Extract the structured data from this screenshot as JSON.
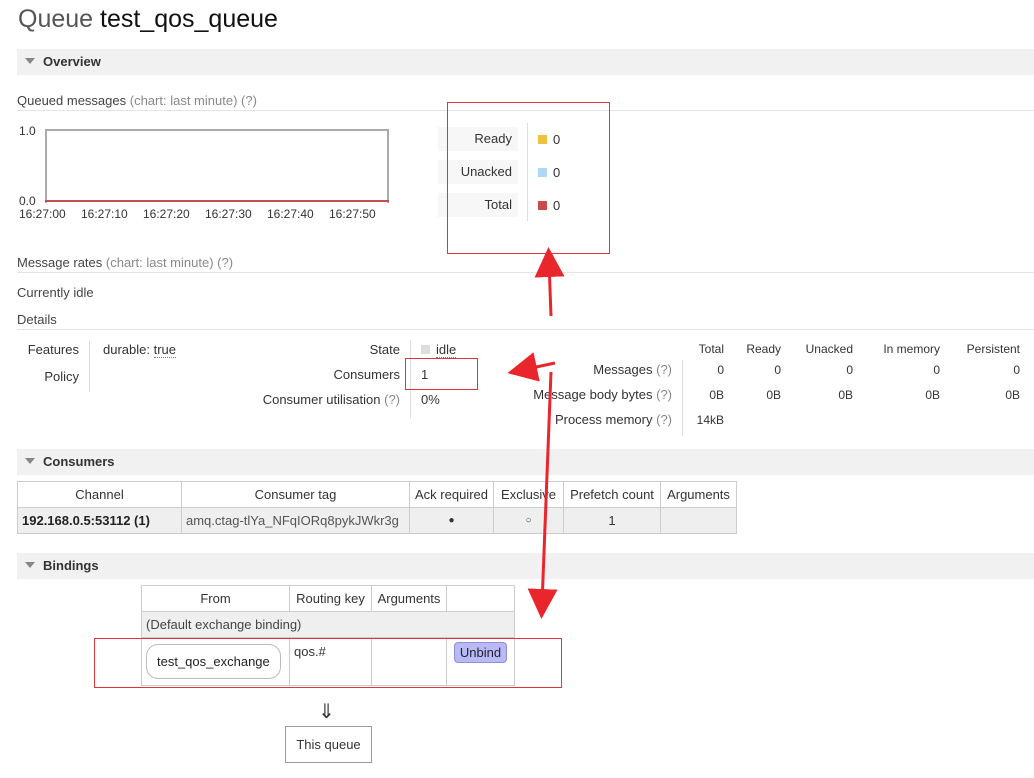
{
  "header": {
    "prefix": "Queue",
    "name": "test_qos_queue"
  },
  "overview": {
    "section_title": "Overview",
    "queued": {
      "title": "Queued messages",
      "chart_hint": "(chart: last minute)",
      "help": "(?)",
      "legend": [
        {
          "label": "Ready",
          "value": "0",
          "color": "#edc240"
        },
        {
          "label": "Unacked",
          "value": "0",
          "color": "#afd8f8"
        },
        {
          "label": "Total",
          "value": "0",
          "color": "#cb4b4b"
        }
      ]
    },
    "rates": {
      "title": "Message rates",
      "chart_hint": "(chart: last minute)",
      "help": "(?)",
      "status": "Currently idle"
    },
    "details_title": "Details",
    "features": {
      "label": "Features",
      "key": "durable:",
      "value": "true"
    },
    "policy": {
      "label": "Policy"
    },
    "state": {
      "label": "State",
      "value": "idle"
    },
    "consumers": {
      "label": "Consumers",
      "value": "1"
    },
    "utilisation": {
      "label": "Consumer utilisation",
      "help": "(?)",
      "value": "0%"
    },
    "stats": {
      "headers": [
        "Total",
        "Ready",
        "Unacked",
        "In memory",
        "Persistent"
      ],
      "messages": {
        "label": "Messages",
        "help": "(?)",
        "values": [
          "0",
          "0",
          "0",
          "0",
          "0"
        ]
      },
      "body_bytes": {
        "label": "Message body bytes",
        "help": "(?)",
        "values": [
          "0B",
          "0B",
          "0B",
          "0B",
          "0B"
        ]
      },
      "process_memory": {
        "label": "Process memory",
        "help": "(?)",
        "value": "14kB"
      }
    }
  },
  "chart_data": {
    "type": "line",
    "x": [
      "16:27:00",
      "16:27:10",
      "16:27:20",
      "16:27:30",
      "16:27:40",
      "16:27:50"
    ],
    "series": [
      {
        "name": "Ready",
        "values": [
          0,
          0,
          0,
          0,
          0,
          0
        ]
      },
      {
        "name": "Unacked",
        "values": [
          0,
          0,
          0,
          0,
          0,
          0
        ]
      },
      {
        "name": "Total",
        "values": [
          0,
          0,
          0,
          0,
          0,
          0
        ]
      }
    ],
    "ylim": [
      0.0,
      1.0
    ],
    "yticks": [
      "1.0",
      "0.0"
    ]
  },
  "consumers_section": {
    "title": "Consumers",
    "headers": [
      "Channel",
      "Consumer tag",
      "Ack required",
      "Exclusive",
      "Prefetch count",
      "Arguments"
    ],
    "rows": [
      {
        "channel": "192.168.0.5:53112 (1)",
        "tag": "amq.ctag-tlYa_NFqIORq8pykJWkr3g",
        "ack": "●",
        "exclusive": "○",
        "prefetch": "1",
        "args": ""
      }
    ]
  },
  "bindings": {
    "title": "Bindings",
    "headers": [
      "From",
      "Routing key",
      "Arguments"
    ],
    "default_row": "(Default exchange binding)",
    "rows": [
      {
        "from": "test_qos_exchange",
        "routing_key": "qos.#",
        "args": "",
        "action": "Unbind"
      }
    ],
    "arrow": "⇓",
    "this_queue": "This queue"
  }
}
